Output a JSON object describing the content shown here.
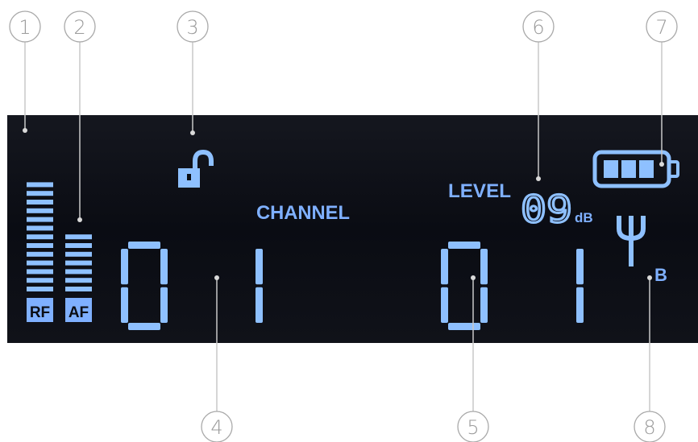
{
  "display": {
    "channel_label": "CHANNEL",
    "level_label": "LEVEL",
    "level_value": "09",
    "level_unit": "dB",
    "rf_label": "RF",
    "af_label": "AF",
    "antenna_label": "B",
    "left_digits": "01",
    "right_digits": "01",
    "rf_level_segments": 13,
    "af_level_segments": 7,
    "battery_bars": 3,
    "lock_state": "unlocked"
  },
  "callouts": [
    "1",
    "2",
    "3",
    "4",
    "5",
    "6",
    "7",
    "8"
  ],
  "colors": {
    "lcd_background": "#0b0d14",
    "segment_lit": "#8ec0ff",
    "label_blue": "#7fb0ff",
    "callout_gray": "#a9a9a9"
  },
  "icons": [
    "padlock-open-icon",
    "battery-icon",
    "antenna-icon"
  ]
}
